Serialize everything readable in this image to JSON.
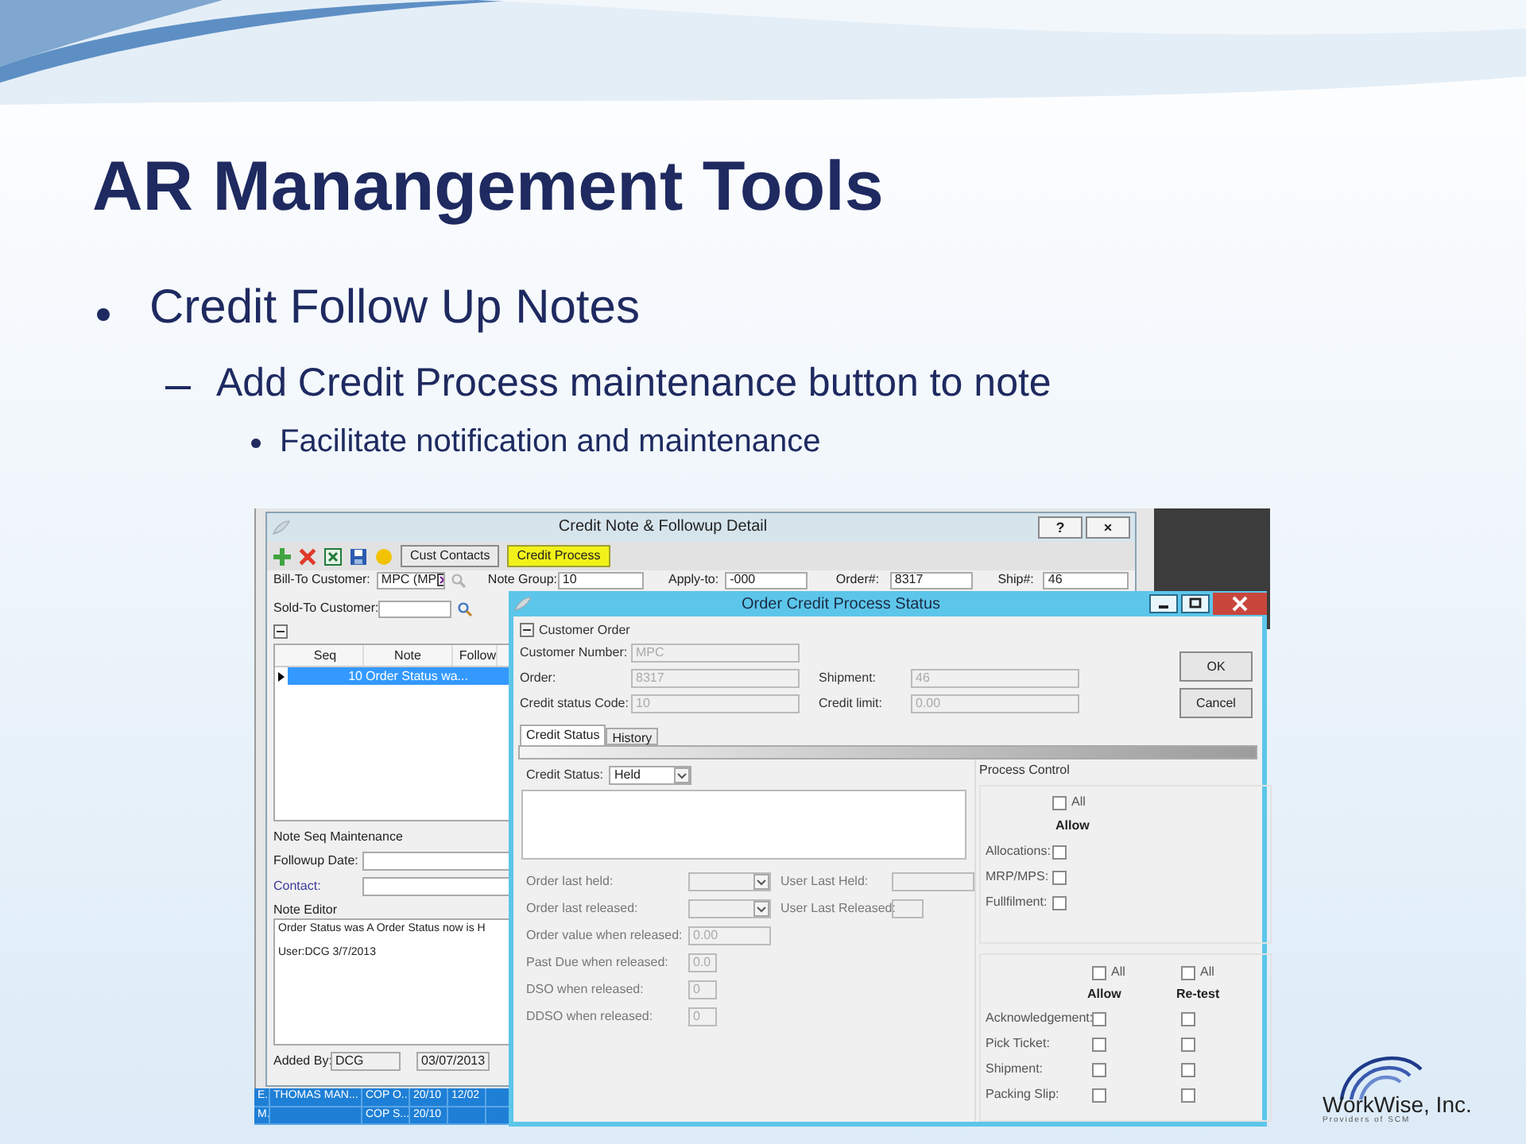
{
  "slide": {
    "title": "AR Manangement Tools",
    "bullets": [
      {
        "text": "Credit Follow Up Notes",
        "children": [
          {
            "text": "Add Credit Process maintenance button to note",
            "children": [
              {
                "text": "Facilitate notification and maintenance"
              }
            ]
          }
        ]
      }
    ]
  },
  "note_window": {
    "title": "Credit Note & Followup Detail",
    "title_buttons": [
      "?",
      "×"
    ],
    "toolbar_buttons": [
      {
        "label": "Cust Contacts",
        "highlighted": false
      },
      {
        "label": "Credit Process",
        "highlighted": true
      }
    ],
    "header_fields": [
      {
        "label": "Bill-To Customer:",
        "value": "MPC (MP",
        "kind": "lookup"
      },
      {
        "label": "Note Group:",
        "value": "10",
        "kind": "text"
      },
      {
        "label": "Apply-to:",
        "value": "-000",
        "kind": "text"
      },
      {
        "label": "Order#:",
        "value": "8317",
        "kind": "text"
      },
      {
        "label": "Ship#:",
        "value": "46",
        "kind": "text"
      }
    ],
    "sold_to": {
      "label": "Sold-To Customer:"
    },
    "grid": {
      "columns": [
        "Seq",
        "Note",
        "Follow"
      ],
      "rows": [
        {
          "seq": "10",
          "note": "Order Status wa...",
          "selected": true
        }
      ]
    },
    "maintenance": {
      "title": "Note Seq Maintenance",
      "fields": [
        {
          "label": "Followup Date:",
          "link": false
        },
        {
          "label": "Contact:",
          "link": true
        }
      ]
    },
    "note_editor": {
      "title": "Note Editor",
      "lines": [
        "Order Status was A Order Status now is H",
        "User:DCG 3/7/2013"
      ]
    },
    "added_by": {
      "label": "Added By:",
      "value": "DCG",
      "date": "03/07/2013"
    }
  },
  "background_list": {
    "rows": [
      {
        "column_1": "E.",
        "column_2": "THOMAS  MAN...",
        "column_3": "COP O...",
        "column_4": "20/10",
        "column_5": "12/02"
      },
      {
        "column_1": "M.",
        "column_3": "COP S...",
        "column_4": "20/10"
      }
    ]
  },
  "status_window": {
    "title": "Order Credit Process Status",
    "group_title": "Customer Order",
    "fields": [
      {
        "label": "Customer Number:",
        "value": "MPC"
      },
      {
        "label": "Order:",
        "value": "8317"
      },
      {
        "label": "Shipment:",
        "value": "46"
      },
      {
        "label": "Credit status Code:",
        "value": "10"
      },
      {
        "label": "Credit limit:",
        "value": "0.00"
      }
    ],
    "buttons": [
      "OK",
      "Cancel"
    ],
    "tabs": [
      {
        "label": "Credit Status",
        "selected": true
      },
      {
        "label": "History",
        "selected": false
      }
    ],
    "credit_status": {
      "label": "Credit Status:",
      "value": "Held"
    },
    "release_fields": [
      {
        "label": "Order last held:",
        "kind": "dropdown"
      },
      {
        "label": "Order last released:",
        "kind": "dropdown"
      },
      {
        "label": "Order value when released:",
        "kind": "text",
        "value": "0.00"
      },
      {
        "label": "Past Due when released:",
        "kind": "short",
        "value": "0.0"
      },
      {
        "label": "DSO when released:",
        "kind": "short",
        "value": "0"
      },
      {
        "label": "DDSO when released:",
        "kind": "short",
        "value": "0"
      }
    ],
    "user_fields": [
      {
        "label": "User Last Held:",
        "kind": "wide"
      },
      {
        "label": "User Last Released:",
        "kind": "short"
      }
    ],
    "process_control": {
      "title": "Process Control",
      "group_1": {
        "all_label": "All",
        "all_checked": false,
        "column": "Allow",
        "rows": [
          {
            "label": "Allocations:",
            "checked": false
          },
          {
            "label": "MRP/MPS:",
            "checked": false
          },
          {
            "label": "Fullfilment:",
            "checked": false
          }
        ]
      },
      "group_2": {
        "columns": [
          {
            "header": "Allow",
            "all_label": "All",
            "all_checked": false
          },
          {
            "header": "Re-test",
            "all_label": "All",
            "all_checked": false
          }
        ],
        "rows": [
          {
            "label": "Acknowledgement:",
            "allow": false,
            "retest": false
          },
          {
            "label": "Pick Ticket:",
            "allow": false,
            "retest": false
          },
          {
            "label": "Shipment:",
            "allow": false,
            "retest": false
          },
          {
            "label": "Packing Slip:",
            "allow": false,
            "retest": false
          }
        ]
      }
    }
  },
  "logo": {
    "name": "WorkWise, Inc.",
    "tagline": "Providers of SCM"
  }
}
